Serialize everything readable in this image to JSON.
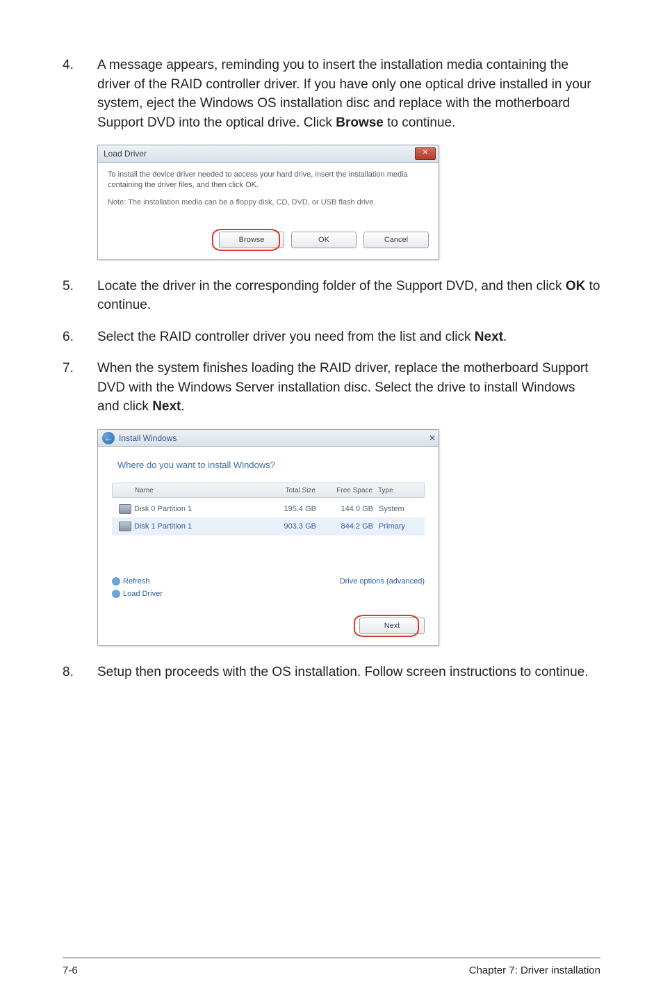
{
  "steps": {
    "s4": {
      "num": "4.",
      "text_a": "A message appears, reminding you to insert the installation media containing the driver of the RAID controller driver. If you have only one optical drive installed in your system, eject the Windows OS installation disc and replace with the motherboard Support DVD into the optical drive. Click ",
      "bold_a": "Browse",
      "text_b": " to continue."
    },
    "s5": {
      "num": "5.",
      "text_a": "Locate the driver in the corresponding folder of the Support DVD, and then click ",
      "bold_a": "OK",
      "text_b": " to continue."
    },
    "s6": {
      "num": "6.",
      "text_a": "Select the RAID controller driver you need from the list and click ",
      "bold_a": "Next",
      "text_b": "."
    },
    "s7": {
      "num": "7.",
      "text_a": "When the system finishes loading the RAID driver, replace the motherboard Support DVD with the Windows Server installation disc. Select the drive to install Windows and click ",
      "bold_a": "Next",
      "text_b": "."
    },
    "s8": {
      "num": "8.",
      "text_a": "Setup then proceeds with the OS installation. Follow screen instructions to continue."
    }
  },
  "load_dialog": {
    "title": "Load Driver",
    "msg": "To install the device driver needed to access your hard drive, insert the installation media containing the driver files, and then click OK.",
    "note": "Note: The installation media can be a floppy disk, CD, DVD, or USB flash drive.",
    "btn_browse": "Browse",
    "btn_ok": "OK",
    "btn_cancel": "Cancel"
  },
  "install_dialog": {
    "title": "Install Windows",
    "question": "Where do you want to install Windows?",
    "headers": {
      "name": "Name",
      "total": "Total Size",
      "free": "Free Space",
      "type": "Type"
    },
    "rows": [
      {
        "name": "Disk 0 Partition 1",
        "total": "195.4 GB",
        "free": "144.0 GB",
        "type": "System"
      },
      {
        "name": "Disk 1 Partition 1",
        "total": "903.3 GB",
        "free": "844.2 GB",
        "type": "Primary"
      }
    ],
    "refresh": "Refresh",
    "load_driver": "Load Driver",
    "advanced": "Drive options (advanced)",
    "next": "Next"
  },
  "footer": {
    "left": "7-6",
    "right": "Chapter 7: Driver installation"
  }
}
